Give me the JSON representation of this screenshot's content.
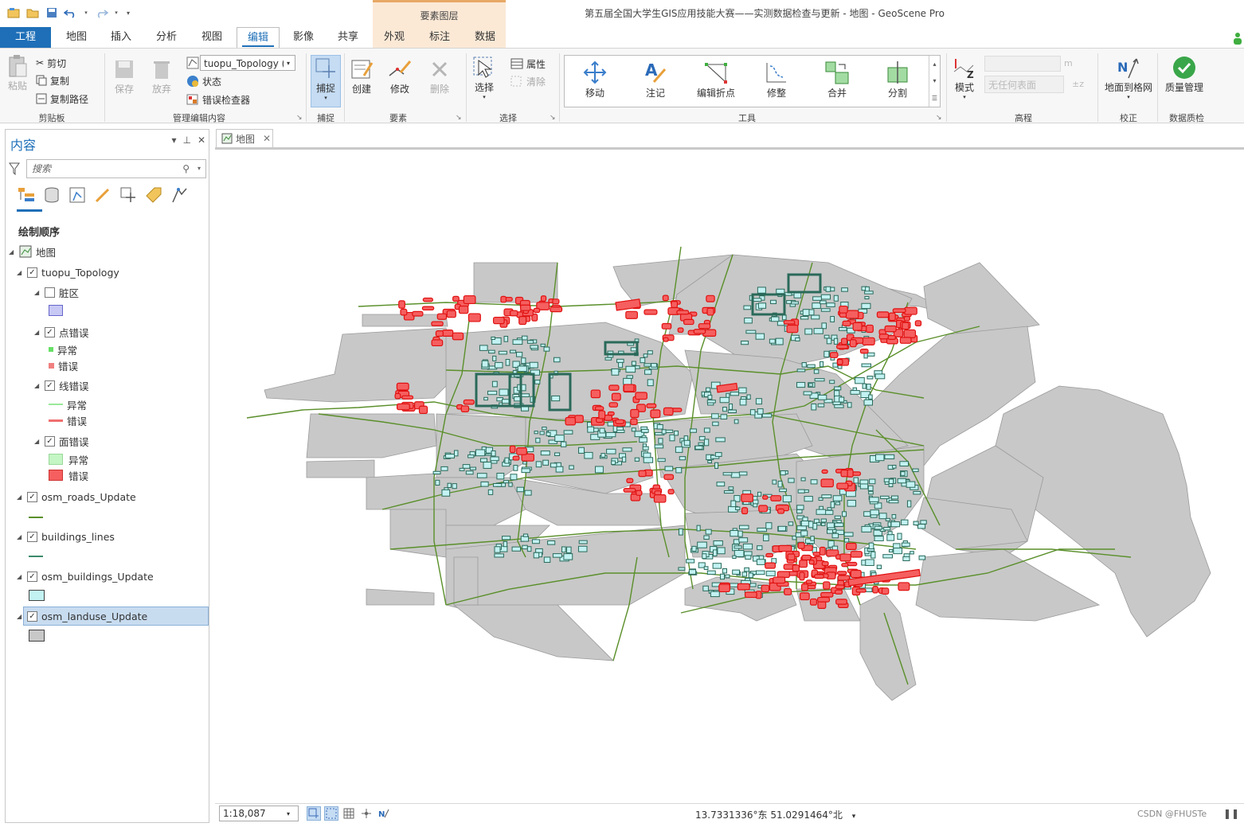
{
  "window": {
    "title": "第五届全国大学生GIS应用技能大赛——实测数据检查与更新 - 地图 - GeoScene Pro",
    "context_group": "要素图层"
  },
  "tabs": [
    "工程",
    "地图",
    "插入",
    "分析",
    "视图",
    "编辑",
    "影像",
    "共享",
    "外观",
    "标注",
    "数据"
  ],
  "ribbon": {
    "clipboard": {
      "paste": "粘贴",
      "cut": "剪切",
      "copy": "复制",
      "copy_path": "复制路径",
      "label": "剪贴板"
    },
    "manage": {
      "save": "保存",
      "discard": "放弃",
      "topology_selector": "tuopu_Topology (地",
      "status": "状态",
      "error_inspector": "错误检查器",
      "label": "管理编辑内容"
    },
    "snapping": {
      "snap": "捕捉",
      "label": "捕捉"
    },
    "features": {
      "create": "创建",
      "modify": "修改",
      "delete": "删除",
      "label": "要素"
    },
    "selection": {
      "select": "选择",
      "attributes": "属性",
      "clear": "清除",
      "label": "选择"
    },
    "tools": {
      "move": "移动",
      "annotate": "注记",
      "edit_vertices": "编辑折点",
      "reshape": "修整",
      "merge": "合并",
      "split": "分割",
      "label": "工具"
    },
    "elevation": {
      "mode": "模式",
      "surface_placeholder": "无任何表面",
      "unit": "m",
      "label": "高程"
    },
    "correct": {
      "ground_to_grid": "地面到格网",
      "label": "校正"
    },
    "quality": {
      "quality_mgmt": "质量管理",
      "label": "数据质检"
    }
  },
  "contents": {
    "title": "内容",
    "search_placeholder": "搜索",
    "draw_order": "绘制顺序",
    "map": "地图",
    "layers": {
      "topology": "tuopu_Topology",
      "dirty": "脏区",
      "point_errors": "点错误",
      "line_errors": "线错误",
      "polygon_errors": "面错误",
      "exception": "异常",
      "error": "错误",
      "roads": "osm_roads_Update",
      "buildings_lines": "buildings_lines",
      "buildings": "osm_buildings_Update",
      "landuse": "osm_landuse_Update"
    }
  },
  "map": {
    "tab": "地图"
  },
  "status": {
    "scale": "1:18,087",
    "coords": "13.7331336°东 51.0291464°北",
    "watermark": "CSDN @FHUSTe"
  },
  "colors": {
    "accent": "#1e6fb8",
    "landuse": "#c8c8c8",
    "road": "#5a8f2a",
    "building": "#c3f2f3",
    "error": "#ff3b3b"
  }
}
